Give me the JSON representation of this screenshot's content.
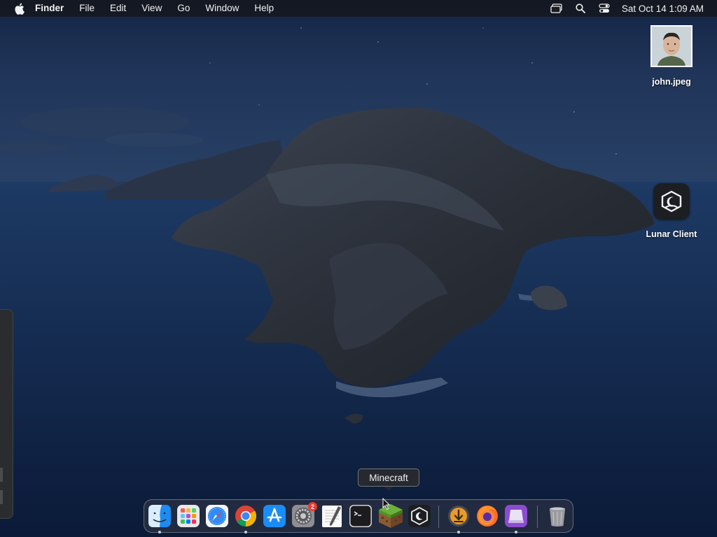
{
  "menubar": {
    "app_name": "Finder",
    "items": [
      "File",
      "Edit",
      "View",
      "Go",
      "Window",
      "Help"
    ],
    "clock": "Sat Oct 14  1:09 AM",
    "status_icons": [
      "screen-mirroring-icon",
      "spotlight-search-icon",
      "control-center-icon"
    ]
  },
  "desktop": {
    "icons": [
      {
        "label": "john.jpeg",
        "type": "image-file"
      },
      {
        "label": "Lunar Client",
        "type": "application"
      }
    ]
  },
  "tooltip": {
    "text": "Minecraft"
  },
  "dock": {
    "items": [
      {
        "name": "Finder",
        "icon": "finder-icon",
        "running": true
      },
      {
        "name": "Launchpad",
        "icon": "launchpad-icon",
        "running": false
      },
      {
        "name": "Safari",
        "icon": "safari-icon",
        "running": false
      },
      {
        "name": "Google Chrome",
        "icon": "chrome-icon",
        "running": true
      },
      {
        "name": "App Store",
        "icon": "app-store-icon",
        "running": false
      },
      {
        "name": "System Preferences",
        "icon": "system-preferences-icon",
        "running": false,
        "badge": "2"
      },
      {
        "name": "TextEdit",
        "icon": "textedit-icon",
        "running": false
      },
      {
        "name": "Terminal",
        "icon": "terminal-icon",
        "running": false
      },
      {
        "name": "Minecraft",
        "icon": "minecraft-icon",
        "running": false
      },
      {
        "name": "Lunar Client",
        "icon": "lunar-client-icon",
        "running": false
      },
      {
        "name": "Downloads",
        "icon": "downloads-icon",
        "running": true
      },
      {
        "name": "Firefox",
        "icon": "firefox-icon",
        "running": false
      },
      {
        "name": "Simulator",
        "icon": "simulator-icon",
        "running": true
      },
      {
        "name": "Trash",
        "icon": "trash-icon",
        "running": false
      }
    ]
  },
  "colors": {
    "menubar_bg": "#14161c",
    "badge": "#e8392f",
    "wallpaper_sky": "#1a2b4a",
    "wallpaper_sea": "#0f2244"
  }
}
